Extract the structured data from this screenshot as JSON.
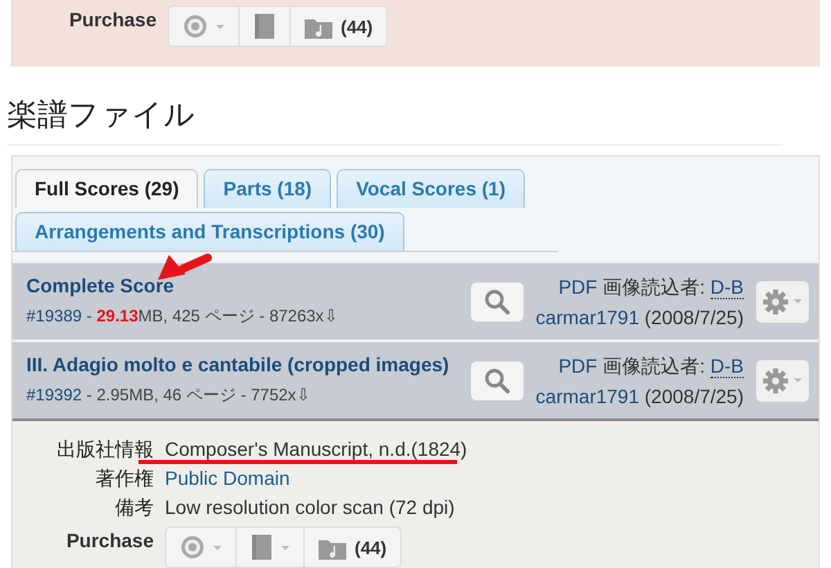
{
  "top_panel": {
    "purchase": {
      "label": "Purchase",
      "buttons": [
        {
          "kind": "disc",
          "caret": true
        },
        {
          "kind": "book",
          "caret": false
        },
        {
          "kind": "folder",
          "caret": false,
          "count": "(44)"
        }
      ]
    }
  },
  "section_title": "楽譜ファイル",
  "tabs": [
    {
      "label": "Full Scores (29)",
      "selected": true
    },
    {
      "label": "Parts (18)",
      "selected": false
    },
    {
      "label": "Vocal Scores (1)",
      "selected": false
    },
    {
      "label": "Arrangements and Transcriptions (30)",
      "selected": false
    }
  ],
  "files": [
    {
      "title": "Complete Score",
      "id": "#19389",
      "separator": "-",
      "size": "29.13",
      "size_large": true,
      "details": "MB, 425 ページ - 87263x⇩",
      "format": "PDF",
      "scanner_label": "画像読込者:",
      "scanner": "D-B",
      "uploader": "carmar1791",
      "date": "(2008/7/25)"
    },
    {
      "title": "III. Adagio molto e cantabile (cropped images)",
      "id": "#19392",
      "separator": "-",
      "size": "2.95",
      "size_large": false,
      "details": "MB, 46 ページ - 7752x⇩",
      "format": "PDF",
      "scanner_label": "画像読込者:",
      "scanner": "D-B",
      "uploader": "carmar1791",
      "date": "(2008/7/25)"
    }
  ],
  "info": [
    {
      "label": "出版社情報",
      "value": "Composer's Manuscript, n.d.(1824)",
      "kind": "text"
    },
    {
      "label": "著作権",
      "value": "Public Domain",
      "kind": "link"
    },
    {
      "label": "備考",
      "value": "Low resolution color scan (72 dpi)",
      "kind": "text"
    }
  ],
  "purchase": {
    "label": "Purchase",
    "buttons": [
      {
        "kind": "disc",
        "caret": true
      },
      {
        "kind": "book",
        "caret": true
      },
      {
        "kind": "folder",
        "caret": false,
        "count": "(44)"
      }
    ]
  }
}
